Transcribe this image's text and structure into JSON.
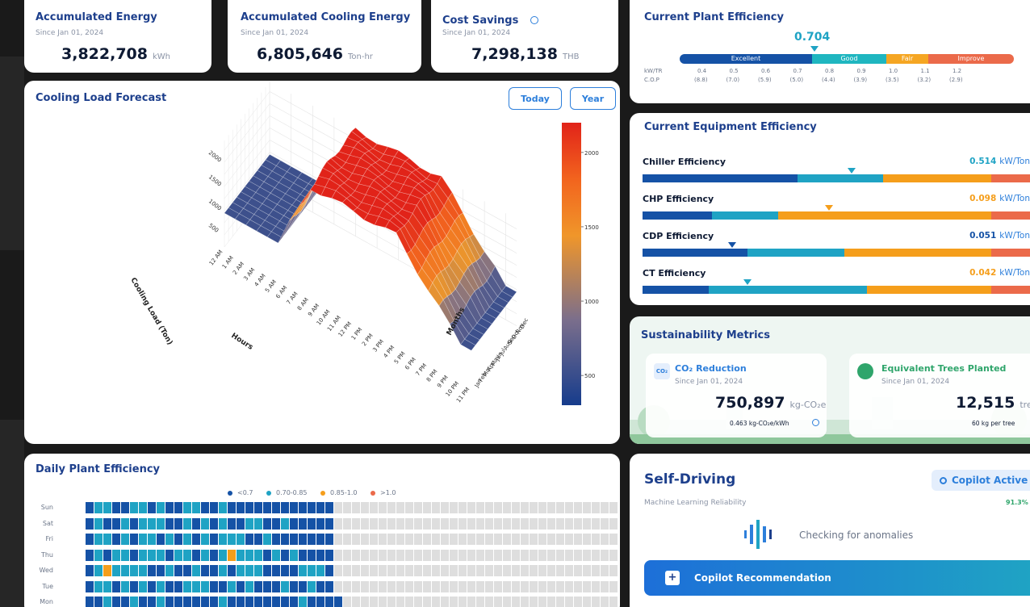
{
  "kpis": [
    {
      "title": "Accumulated Energy",
      "since": "Since Jan 01, 2024",
      "value": "3,822,708",
      "unit": "kWh"
    },
    {
      "title": "Accumulated Cooling Energy",
      "since": "Since Jan 01, 2024",
      "value": "6,805,646",
      "unit": "Ton-hr"
    },
    {
      "title": "Cost Savings",
      "since": "Since Jan 01, 2024",
      "value": "7,298,138",
      "unit": "THB"
    }
  ],
  "plant_eff": {
    "title": "Current Plant Efficiency",
    "value": "0.704",
    "segments": [
      "Excellent",
      "Good",
      "Fair",
      "Improve"
    ],
    "row1_label": "kW/TR",
    "row2_label": "C.O.P",
    "kwtr": [
      "0.4",
      "0.5",
      "0.6",
      "0.7",
      "0.8",
      "0.9",
      "1.0",
      "1.1",
      "1.2"
    ],
    "cop": [
      "(8.8)",
      "(7.0)",
      "(5.9)",
      "(5.0)",
      "(4.4)",
      "(3.9)",
      "(3.5)",
      "(3.2)",
      "(2.9)"
    ]
  },
  "forecast": {
    "title": "Cooling Load Forecast",
    "btn_today": "Today",
    "btn_year": "Year",
    "zlabel": "Cooling Load (Ton)",
    "xlabel": "Hours",
    "ylabel": "Months",
    "z_ticks": [
      "2000",
      "1500",
      "1000",
      "500"
    ],
    "hours": [
      "12 AM",
      "1 AM",
      "2 AM",
      "3 AM",
      "4 AM",
      "5 AM",
      "6 AM",
      "7 AM",
      "8 AM",
      "9 AM",
      "10 AM",
      "11 AM",
      "12 PM",
      "1 PM",
      "2 PM",
      "3 PM",
      "4 PM",
      "5 PM",
      "6 PM",
      "7 PM",
      "8 PM",
      "9 PM",
      "10 PM",
      "11 PM"
    ],
    "months": [
      "Jan",
      "Feb",
      "Mar",
      "Apr",
      "May",
      "Jun",
      "Jul",
      "Aug",
      "Sep",
      "Oct",
      "Nov",
      "Dec"
    ],
    "colorbar_ticks": [
      "2000",
      "1500",
      "1000",
      "500"
    ]
  },
  "equip": {
    "title": "Current Equipment Efficiency",
    "rows": [
      {
        "label": "Chiller Efficiency",
        "value": "0.514",
        "unit": "kW/Ton",
        "color": "#1fa3c4",
        "marker": 0.53
      },
      {
        "label": "CHP Efficiency",
        "value": "0.098",
        "unit": "kW/Ton",
        "color": "#f59e1b",
        "marker": 0.47
      },
      {
        "label": "CDP Efficiency",
        "value": "0.051",
        "unit": "kW/Ton",
        "color": "#1552a6",
        "marker": 0.22
      },
      {
        "label": "CT Efficiency",
        "value": "0.042",
        "unit": "kW/Ton",
        "color": "#f59e1b",
        "marker": 0.26
      }
    ]
  },
  "sustain": {
    "title": "Sustainability Metrics",
    "co2": {
      "badge": "CO₂",
      "title": "CO₂ Reduction",
      "since": "Since Jan 01, 2024",
      "value": "750,897",
      "unit": "kg-CO₂e",
      "note": "0.463 kg-CO₂e/kWh"
    },
    "trees": {
      "title": "Equivalent Trees Planted",
      "since": "Since Jan 01, 2024",
      "value": "12,515",
      "unit": "trees",
      "note": "60 kg per tree"
    }
  },
  "daily": {
    "title": "Daily Plant Efficiency",
    "legend": [
      "<0.7",
      "0.70-0.85",
      "0.85-1.0",
      ">1.0"
    ],
    "days": [
      "Sun",
      "Sat",
      "Fri",
      "Thu",
      "Wed",
      "Tue",
      "Mon"
    ]
  },
  "selfdriving": {
    "title": "Self-Driving",
    "badge": "Copilot Active",
    "ml_label": "Machine Learning Reliability",
    "ml_value": "91.3%",
    "status": "Checking for anomalies",
    "recommend": "Copilot Recommendation"
  },
  "colors": {
    "dark_blue": "#1552a6",
    "teal": "#1fa3c4",
    "orange": "#f59e1b",
    "red": "#eb6a4a"
  }
}
